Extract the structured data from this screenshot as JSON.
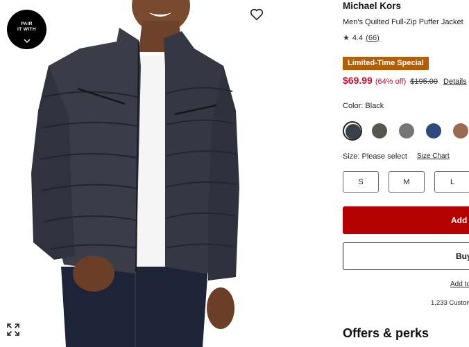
{
  "gallery": {
    "pair_badge_line1": "PAIR",
    "pair_badge_line2": "IT WITH",
    "icons": [
      "pair-it-with-chevron-icon",
      "heart-icon",
      "expand-icon"
    ]
  },
  "product": {
    "brand": "Michael Kors",
    "name": "Men's Quilted Full-Zip Puffer Jacket",
    "rating_star": "★",
    "rating": "4.4",
    "review_count": "(66)",
    "promo_badge": "Limited-Time Special",
    "price": "$69.99",
    "discount": "(64% off)",
    "original_price": "$195.00",
    "details_link": "Details"
  },
  "color": {
    "label": "Color: Black",
    "selected_index": 0,
    "swatches": [
      {
        "name": "Black",
        "hex": "#3b3f4c"
      },
      {
        "name": "Olive",
        "hex": "#55564f"
      },
      {
        "name": "Gray",
        "hex": "#777478"
      },
      {
        "name": "Navy",
        "hex": "#2e4a7c"
      },
      {
        "name": "Brown",
        "hex": "#9a6a52"
      }
    ]
  },
  "size": {
    "label": "Size: Please select",
    "chart_link": "Size Chart",
    "options": [
      "S",
      "M",
      "L"
    ]
  },
  "actions": {
    "add_label": "Add",
    "buy_label": "Buy",
    "add_to_link": "Add to",
    "customers_text": "1,233 Custom"
  },
  "offers": {
    "heading": "Offers & perks"
  },
  "colors": {
    "accent_red": "#b50000",
    "price_red": "#c20a2d",
    "promo_badge_bg": "#b25f07",
    "jacket": "#3a3d48"
  }
}
